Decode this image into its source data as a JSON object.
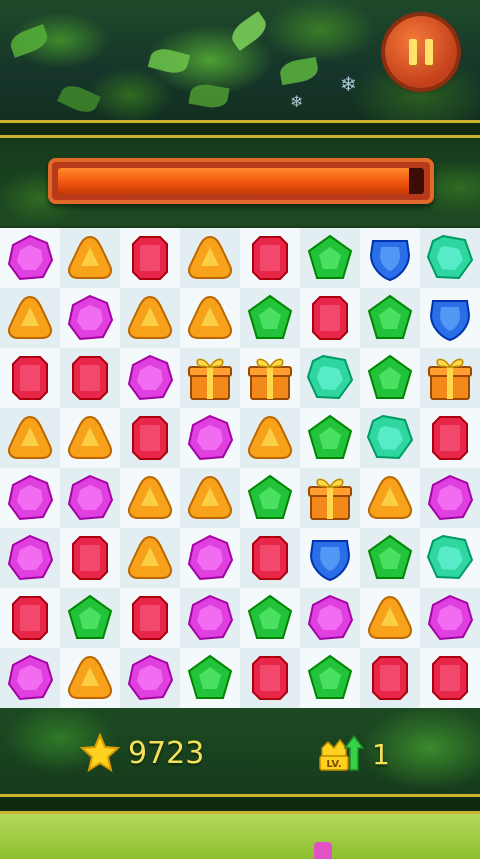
{
  "hud": {
    "score": "9723",
    "level": "1",
    "level_badge_text": "LV.",
    "progress_fraction": 0.96
  },
  "board": {
    "rows": 8,
    "cols": 8,
    "tiles": [
      [
        "purple",
        "orange",
        "red",
        "orange",
        "red",
        "green",
        "blue",
        "teal"
      ],
      [
        "orange",
        "purple",
        "orange",
        "orange",
        "green",
        "red",
        "green",
        "blue"
      ],
      [
        "red",
        "red",
        "purple",
        "gift",
        "gift",
        "teal",
        "green",
        "gift"
      ],
      [
        "orange",
        "orange",
        "red",
        "purple",
        "orange",
        "green",
        "teal",
        "red"
      ],
      [
        "purple",
        "purple",
        "orange",
        "orange",
        "green",
        "gift",
        "orange",
        "purple"
      ],
      [
        "purple",
        "red",
        "orange",
        "purple",
        "red",
        "blue",
        "green",
        "teal"
      ],
      [
        "red",
        "green",
        "red",
        "purple",
        "green",
        "purple",
        "orange",
        "purple"
      ],
      [
        "purple",
        "orange",
        "purple",
        "green",
        "red",
        "green",
        "red",
        "red"
      ]
    ]
  },
  "colors": {
    "purple": "#e040e0",
    "orange": "#f7a21a",
    "red": "#e8264a",
    "green": "#22c23a",
    "blue": "#2a6fe8",
    "teal": "#2fd6a0",
    "gift": "#f2891a"
  },
  "icons": {
    "pause": "pause-icon",
    "star": "star-icon",
    "level": "level-up-icon"
  }
}
